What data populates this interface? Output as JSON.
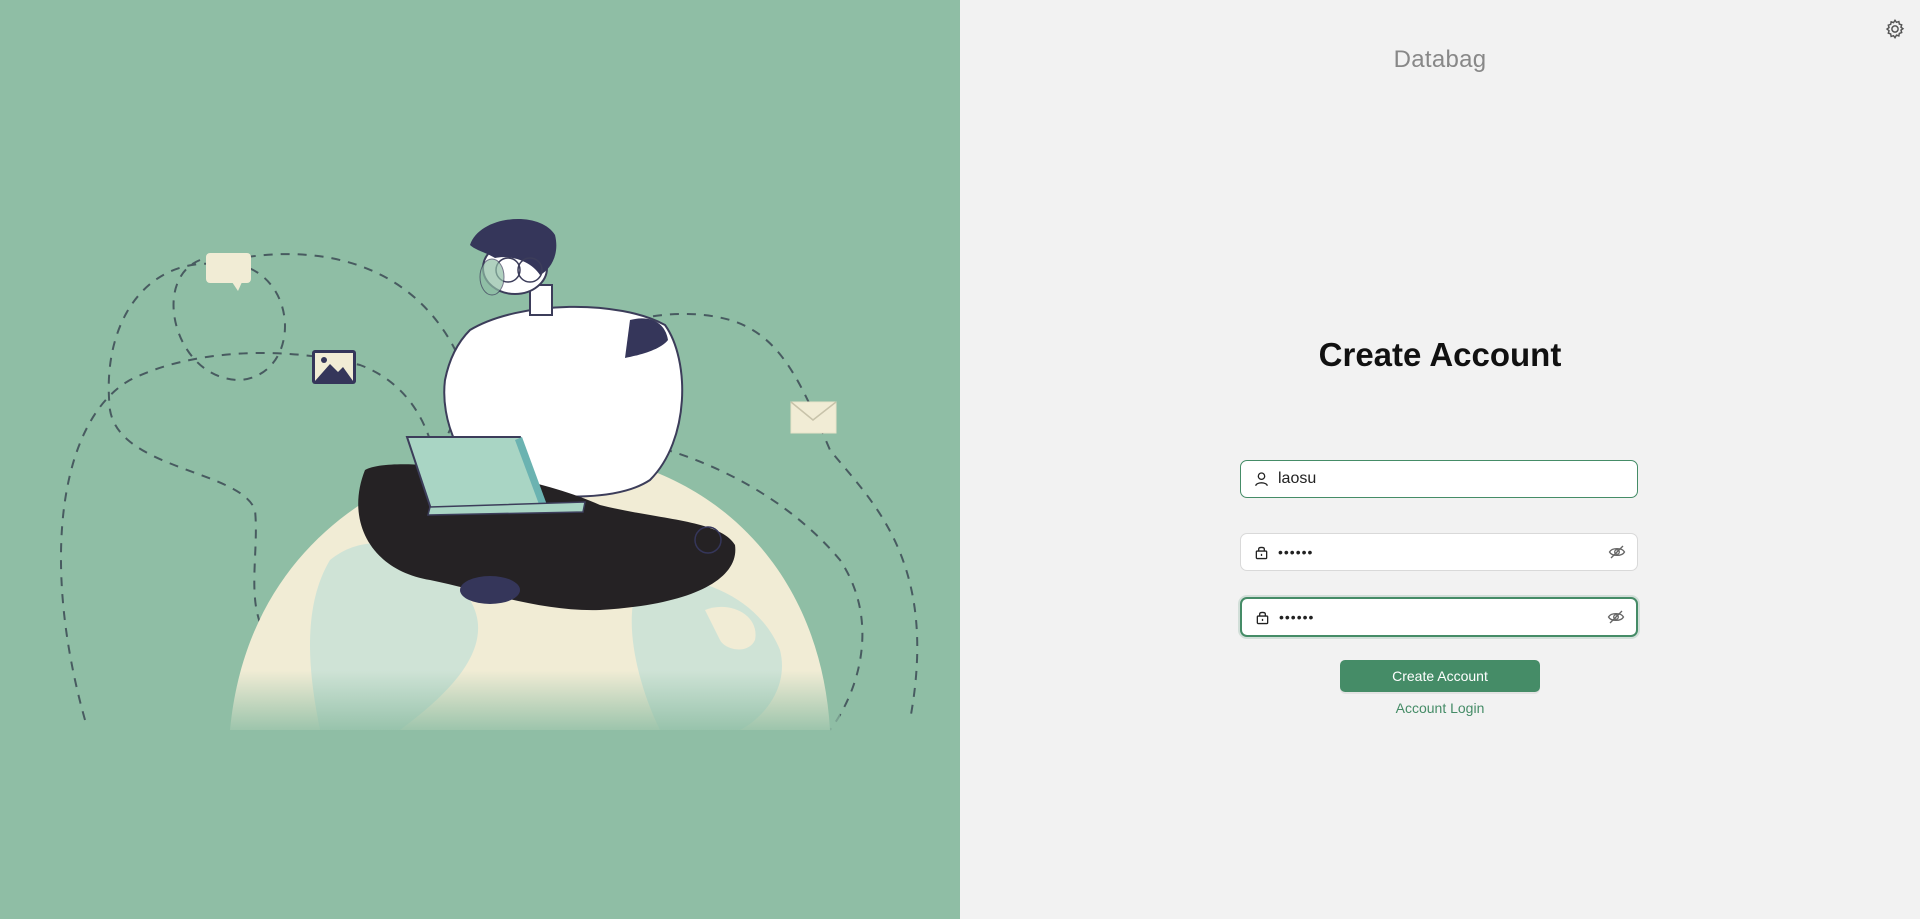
{
  "app": {
    "name": "Databag"
  },
  "form": {
    "title": "Create Account",
    "username": {
      "value": "laosu",
      "icon": "user-icon"
    },
    "password": {
      "value": "123456",
      "icon": "lock-icon",
      "toggle_icon": "eye-invisible-icon"
    },
    "confirm": {
      "value": "123456",
      "icon": "lock-icon",
      "toggle_icon": "eye-invisible-icon"
    },
    "submit_label": "Create Account",
    "login_link": "Account Login"
  },
  "colors": {
    "accent": "#458c67",
    "left_background": "#8fbea5",
    "right_background": "#f2f2f2"
  }
}
